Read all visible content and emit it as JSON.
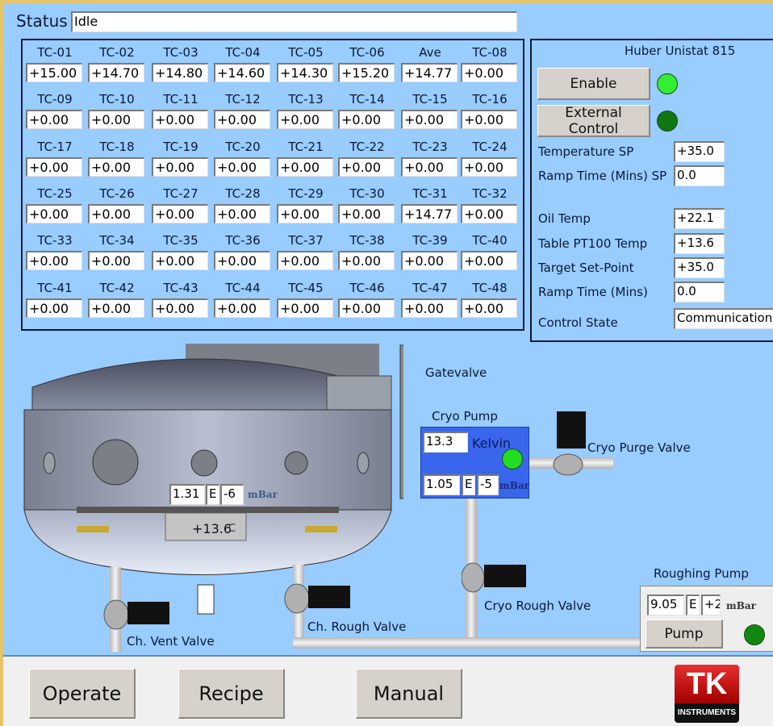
{
  "status": {
    "label": "Status",
    "value": "Idle"
  },
  "thermocouples": [
    {
      "label": "TC-01",
      "value": "+15.00"
    },
    {
      "label": "TC-02",
      "value": "+14.70"
    },
    {
      "label": "TC-03",
      "value": "+14.80"
    },
    {
      "label": "TC-04",
      "value": "+14.60"
    },
    {
      "label": "TC-05",
      "value": "+14.30"
    },
    {
      "label": "TC-06",
      "value": "+15.20"
    },
    {
      "label": "Ave",
      "value": "+14.77"
    },
    {
      "label": "TC-08",
      "value": "+0.00"
    },
    {
      "label": "TC-09",
      "value": "+0.00"
    },
    {
      "label": "TC-10",
      "value": "+0.00"
    },
    {
      "label": "TC-11",
      "value": "+0.00"
    },
    {
      "label": "TC-12",
      "value": "+0.00"
    },
    {
      "label": "TC-13",
      "value": "+0.00"
    },
    {
      "label": "TC-14",
      "value": "+0.00"
    },
    {
      "label": "TC-15",
      "value": "+0.00"
    },
    {
      "label": "TC-16",
      "value": "+0.00"
    },
    {
      "label": "TC-17",
      "value": "+0.00"
    },
    {
      "label": "TC-18",
      "value": "+0.00"
    },
    {
      "label": "TC-19",
      "value": "+0.00"
    },
    {
      "label": "TC-20",
      "value": "+0.00"
    },
    {
      "label": "TC-21",
      "value": "+0.00"
    },
    {
      "label": "TC-22",
      "value": "+0.00"
    },
    {
      "label": "TC-23",
      "value": "+0.00"
    },
    {
      "label": "TC-24",
      "value": "+0.00"
    },
    {
      "label": "TC-25",
      "value": "+0.00"
    },
    {
      "label": "TC-26",
      "value": "+0.00"
    },
    {
      "label": "TC-27",
      "value": "+0.00"
    },
    {
      "label": "TC-28",
      "value": "+0.00"
    },
    {
      "label": "TC-29",
      "value": "+0.00"
    },
    {
      "label": "TC-30",
      "value": "+0.00"
    },
    {
      "label": "TC-31",
      "value": "+14.77"
    },
    {
      "label": "TC-32",
      "value": "+0.00"
    },
    {
      "label": "TC-33",
      "value": "+0.00"
    },
    {
      "label": "TC-34",
      "value": "+0.00"
    },
    {
      "label": "TC-35",
      "value": "+0.00"
    },
    {
      "label": "TC-36",
      "value": "+0.00"
    },
    {
      "label": "TC-37",
      "value": "+0.00"
    },
    {
      "label": "TC-38",
      "value": "+0.00"
    },
    {
      "label": "TC-39",
      "value": "+0.00"
    },
    {
      "label": "TC-40",
      "value": "+0.00"
    },
    {
      "label": "TC-41",
      "value": "+0.00"
    },
    {
      "label": "TC-42",
      "value": "+0.00"
    },
    {
      "label": "TC-43",
      "value": "+0.00"
    },
    {
      "label": "TC-44",
      "value": "+0.00"
    },
    {
      "label": "TC-45",
      "value": "+0.00"
    },
    {
      "label": "TC-46",
      "value": "+0.00"
    },
    {
      "label": "TC-47",
      "value": "+0.00"
    },
    {
      "label": "TC-48",
      "value": "+0.00"
    }
  ],
  "huber": {
    "title": "Huber Unistat 815",
    "enable_label": "Enable",
    "enable_led": "#33ee33",
    "external_control_label": "External Control",
    "external_led": "#117711",
    "temperature_sp_label": "Temperature SP",
    "temperature_sp": "+35.0",
    "ramp_time_sp_label": "Ramp Time (Mins) SP",
    "ramp_time_sp": "0.0",
    "oil_temp_label": "Oil Temp",
    "oil_temp": "+22.1",
    "table_pt100_label": "Table PT100 Temp",
    "table_pt100": "+13.6",
    "target_setpoint_label": "Target Set-Point",
    "target_setpoint": "+35.0",
    "ramp_time_label": "Ramp Time (Mins)",
    "ramp_time": "0.0",
    "control_state_label": "Control State",
    "control_state": "Communication"
  },
  "chamber": {
    "pressure_mantissa": "1.31",
    "pressure_e": "E",
    "pressure_exp": "-6",
    "pressure_unit": "mBar",
    "table_temp": "+13.6",
    "table_temp_unit": "C"
  },
  "gatevalve_label": "Gatevalve",
  "cryo_pump": {
    "label": "Cryo Pump",
    "temp": "13.3",
    "temp_unit": "Kelvin",
    "led": "#22dd22",
    "pressure_mantissa": "1.05",
    "pressure_e": "E",
    "pressure_exp": "-5",
    "pressure_unit": "mBar"
  },
  "valves": {
    "cryo_purge": "Cryo Purge Valve",
    "cryo_rough": "Cryo Rough Valve",
    "ch_rough": "Ch. Rough Valve",
    "ch_vent": "Ch. Vent Valve"
  },
  "roughing_pump": {
    "label": "Roughing Pump",
    "pressure_mantissa": "9.05",
    "pressure_e": "E",
    "pressure_exp": "+2",
    "pressure_unit": "mBar",
    "pump_label": "Pump",
    "led": "#118811"
  },
  "nav": {
    "operate": "Operate",
    "recipe": "Recipe",
    "manual": "Manual"
  },
  "logo": {
    "top": "TK",
    "bottom": "INSTRUMENTS"
  }
}
